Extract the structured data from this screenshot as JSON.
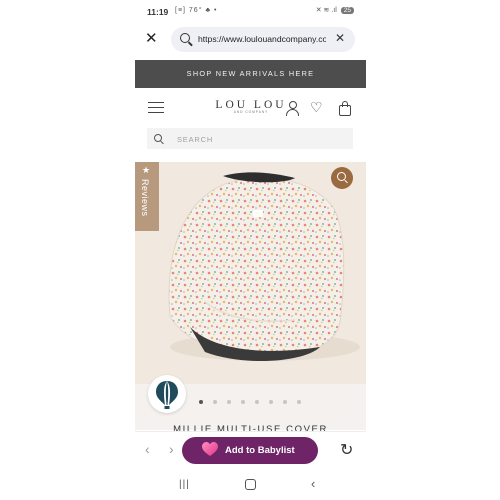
{
  "status_bar": {
    "time": "11:19",
    "left_icons": "[≡] 76° ♣ •",
    "right_icons": "✕ ≋ .ıl",
    "battery": "25"
  },
  "browser": {
    "url": "https://www.loulouandcompany.com",
    "close_icon": "close-icon",
    "clear_icon": "close-icon"
  },
  "promo": {
    "text": "SHOP NEW ARRIVALS HERE"
  },
  "header": {
    "logo_main": "LOU LOU",
    "logo_sub": "AND COMPANY",
    "menu_icon": "hamburger-icon",
    "account_icon": "user-icon",
    "wishlist_icon": "heart-icon",
    "cart_icon": "bag-icon"
  },
  "search": {
    "placeholder": "SEARCH"
  },
  "product": {
    "reviews_label": "Reviews",
    "reviews_icon": "★",
    "zoom_icon": "zoom-icon",
    "title": "MILLIE MULTI-USE COVER",
    "image_count": 8,
    "active_image": 1,
    "colors": {
      "tab": "#b79a7d",
      "zoom": "#9a6a40",
      "backdrop": "#f1e9df"
    }
  },
  "actions": {
    "back_arrow": "‹",
    "forward_arrow": "›",
    "babylist_label": "Add to Babylist",
    "babylist_color": "#6e2466",
    "refresh_icon": "↻"
  },
  "system_nav": {
    "recent": "|||",
    "home": "home-icon",
    "back": "‹"
  }
}
